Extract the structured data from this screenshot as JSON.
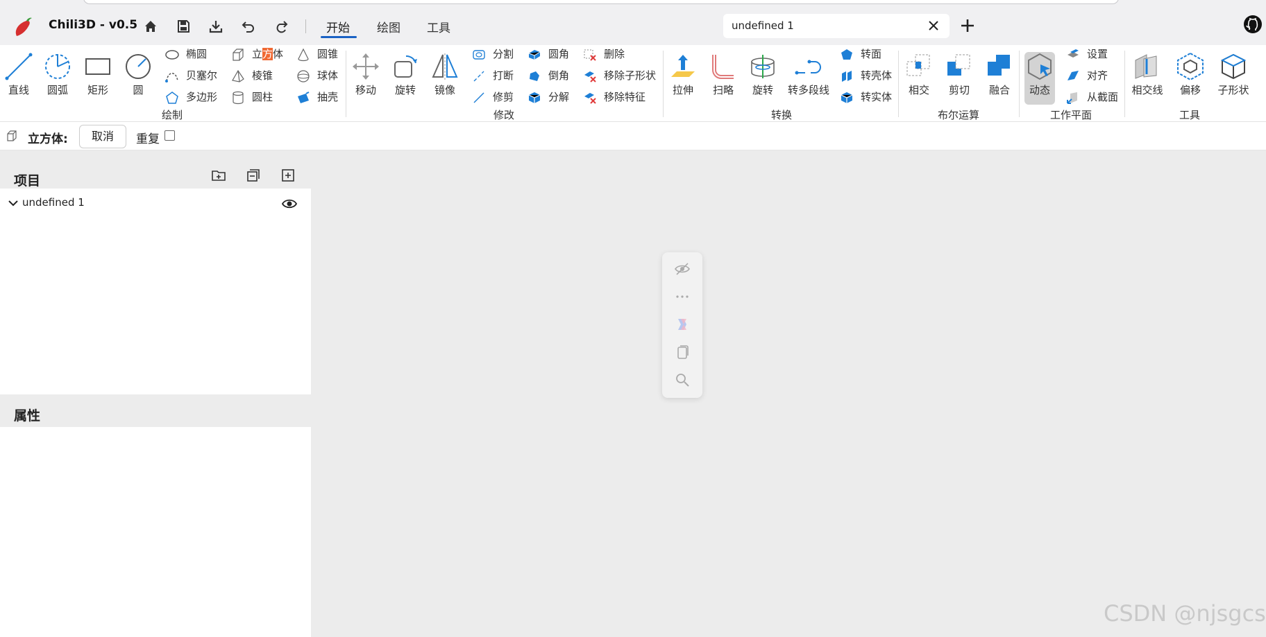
{
  "app": {
    "title": "Chili3D - v0.5"
  },
  "tabs": {
    "start": "开始",
    "draw": "绘图",
    "tools": "工具"
  },
  "document_tab": {
    "label": "undefined 1"
  },
  "colors": {
    "accent": "#1a62c4",
    "icon_blue": "#1e7fd6",
    "highlight": "#f06a34"
  },
  "ribbon": {
    "draw": {
      "line": "直线",
      "arc": "圆弧",
      "rect": "矩形",
      "circle": "圆",
      "ellipse": "椭圆",
      "bezier": "贝塞尔",
      "polygon": "多边形",
      "box_pre": "立",
      "box_hl": "方",
      "box_post": "体",
      "pyramid": "棱锥",
      "cylinder": "圆柱",
      "cone": "圆锥",
      "sphere": "球体",
      "shell": "抽壳",
      "group": "绘制"
    },
    "modify": {
      "move": "移动",
      "rotate": "旋转",
      "mirror": "镜像",
      "split": "分割",
      "break": "打断",
      "trim": "修剪",
      "fillet": "圆角",
      "chamfer": "倒角",
      "explode": "分解",
      "delete": "删除",
      "remove_subshape": "移除子形状",
      "remove_feature": "移除特征",
      "group": "修改"
    },
    "convert": {
      "extrude": "拉伸",
      "sweep": "扫略",
      "revolve": "旋转",
      "to_polyline": "转多段线",
      "to_face": "转面",
      "to_shell": "转壳体",
      "to_solid": "转实体",
      "group": "转换"
    },
    "boolean": {
      "intersect": "相交",
      "cut": "剪切",
      "fuse": "融合",
      "group": "布尔运算"
    },
    "workplane": {
      "dynamic": "动态",
      "set": "设置",
      "align": "对齐",
      "from_section": "从截面",
      "group": "工作平面"
    },
    "tools": {
      "intersection_line": "相交线",
      "offset": "偏移",
      "sub_shape": "子形状",
      "group": "工具"
    }
  },
  "command": {
    "label": "立方体:",
    "cancel": "取消",
    "repeat": "重复",
    "repeat_checked": false
  },
  "project_panel": {
    "title": "项目",
    "tree_item": "undefined 1"
  },
  "properties_panel": {
    "title": "属性"
  },
  "watermark": "CSDN @njsgcs"
}
